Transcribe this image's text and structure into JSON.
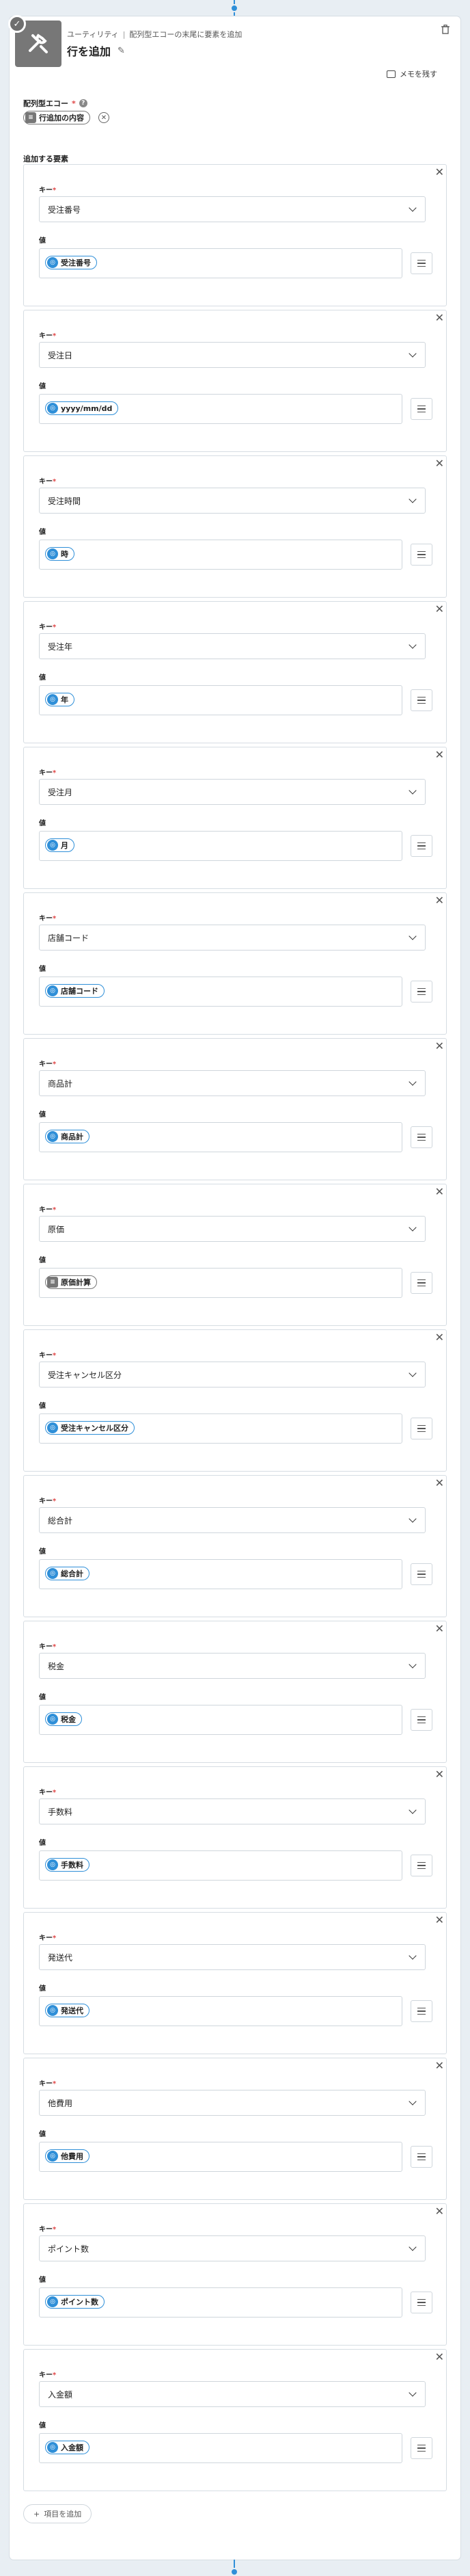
{
  "header": {
    "breadcrumb_category": "ユーティリティ",
    "breadcrumb_action": "配列型エコーの末尾に要素を追加",
    "title": "行を追加",
    "memo_toggle": "メモを残す"
  },
  "array_field": {
    "label": "配列型エコー",
    "pill_label": "行追加の内容"
  },
  "elements_label": "追加する要素",
  "key_label": "キー",
  "value_label": "値",
  "items": [
    {
      "key": "受注番号",
      "value": "受注番号",
      "pill_style": "blue"
    },
    {
      "key": "受注日",
      "value": "yyyy/mm/dd",
      "pill_style": "blue"
    },
    {
      "key": "受注時間",
      "value": "時",
      "pill_style": "blue"
    },
    {
      "key": "受注年",
      "value": "年",
      "pill_style": "blue"
    },
    {
      "key": "受注月",
      "value": "月",
      "pill_style": "blue"
    },
    {
      "key": "店舗コード",
      "value": "店舗コード",
      "pill_style": "blue"
    },
    {
      "key": "商品計",
      "value": "商品計",
      "pill_style": "blue"
    },
    {
      "key": "原価",
      "value": "原価計算",
      "pill_style": "gray"
    },
    {
      "key": "受注キャンセル区分",
      "value": "受注キャンセル区分",
      "pill_style": "blue"
    },
    {
      "key": "総合計",
      "value": "総合計",
      "pill_style": "blue"
    },
    {
      "key": "税金",
      "value": "税金",
      "pill_style": "blue"
    },
    {
      "key": "手数料",
      "value": "手数料",
      "pill_style": "blue"
    },
    {
      "key": "発送代",
      "value": "発送代",
      "pill_style": "blue"
    },
    {
      "key": "他費用",
      "value": "他費用",
      "pill_style": "blue"
    },
    {
      "key": "ポイント数",
      "value": "ポイント数",
      "pill_style": "blue"
    },
    {
      "key": "入金額",
      "value": "入金額",
      "pill_style": "blue"
    }
  ],
  "add_item_label": "項目を追加",
  "colors": {
    "accent": "#2f8fd8",
    "background": "#e8eef3",
    "required": "#e04646"
  }
}
